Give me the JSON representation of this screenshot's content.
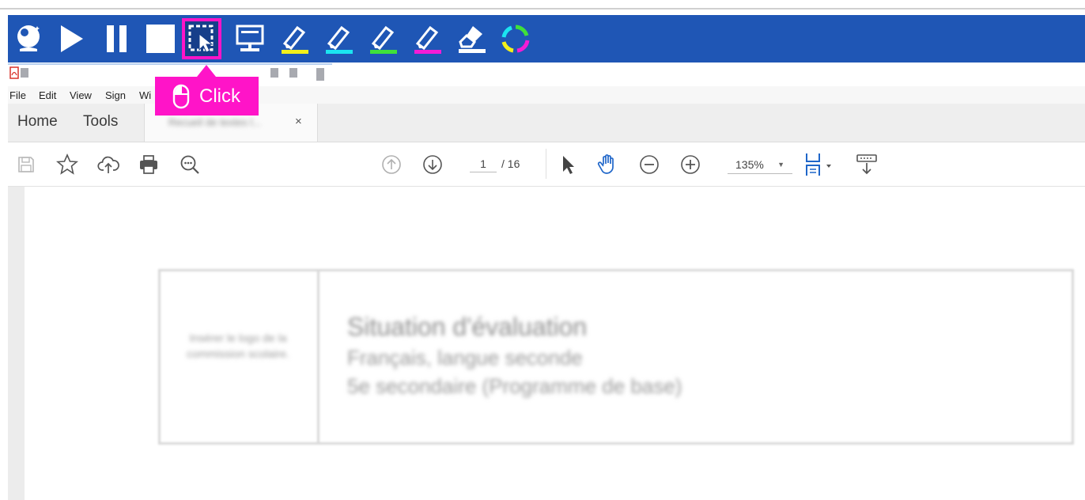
{
  "recorder_toolbar": {
    "buttons": [
      "webcam",
      "play",
      "pause",
      "stop",
      "select-area",
      "screen",
      "highlighter-yellow",
      "highlighter-cyan",
      "highlighter-green",
      "highlighter-magenta",
      "eraser",
      "refresh"
    ],
    "selected": "select-area",
    "colors": {
      "bar": "#1f56b5",
      "highlight": "#ff14c8",
      "yellow": "#f3f01a",
      "cyan": "#1be4f0",
      "green": "#3fe03a",
      "magenta": "#f41cd6"
    }
  },
  "callout": {
    "label": "Click",
    "icon": "mouse-icon"
  },
  "menu": {
    "items": [
      "File",
      "Edit",
      "View",
      "Sign",
      "Wi"
    ]
  },
  "tabs": {
    "home": "Home",
    "tools": "Tools",
    "doc_title": "Recueil de textes l...",
    "close": "×"
  },
  "toolbar": {
    "page_current": "1",
    "page_total": "/ 16",
    "zoom": "135%",
    "icons": [
      "save-icon",
      "bookmark-star-icon",
      "upload-cloud-icon",
      "print-icon",
      "search-zoom-icon",
      "page-up-icon",
      "page-down-icon",
      "select-arrow-icon",
      "hand-tool-icon",
      "zoom-out-icon",
      "zoom-in-icon",
      "fit-page-icon",
      "scroll-mode-icon"
    ]
  },
  "document": {
    "logo_placeholder": "Insérer le logo de la commission scolaire.",
    "title": "Situation d'évaluation",
    "subtitle1": "Français, langue seconde",
    "subtitle2": "5e secondaire (Programme de base)"
  }
}
